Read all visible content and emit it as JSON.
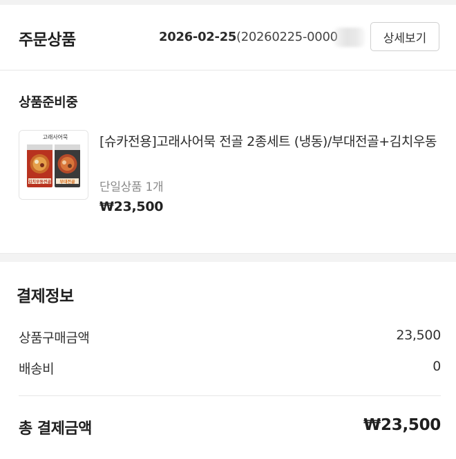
{
  "order": {
    "section_title": "주문상품",
    "date": "2026-02-25",
    "order_number": "(20260225-0000",
    "detail_button": "상세보기"
  },
  "product": {
    "status": "상품준비중",
    "name": "[슈카전용]고래사어묵 전골 2종세트 (냉동)/부대전골+김치우동",
    "option": "단일상품 1개",
    "price": "₩23,500",
    "thumbnail": {
      "brand_text": "고래사어묵",
      "pack_left_label": "김치우동전골",
      "pack_right_label": "부대전골"
    }
  },
  "payment": {
    "title": "결제정보",
    "rows": [
      {
        "label": "상품구매금액",
        "value": "23,500"
      },
      {
        "label": "배송비",
        "value": "0"
      }
    ],
    "total_label": "총 결제금액",
    "total_value": "₩23,500"
  },
  "colors": {
    "text_primary": "#222222",
    "text_muted": "#8a8a8a",
    "divider": "#e6e6e6",
    "section_gap": "#f3f3f3"
  }
}
